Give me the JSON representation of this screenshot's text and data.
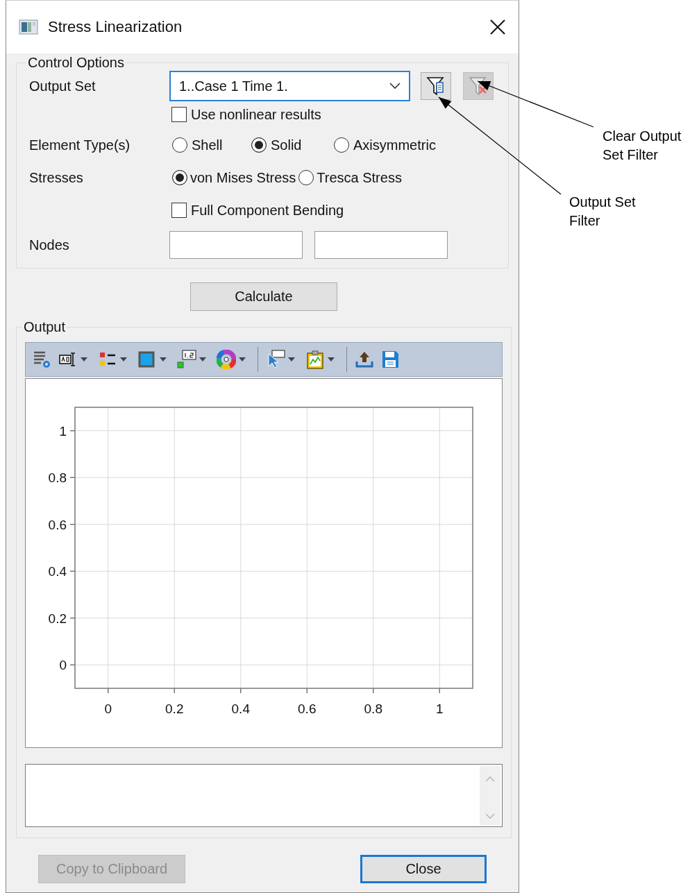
{
  "window": {
    "title": "Stress Linearization"
  },
  "control_options": {
    "title": "Control Options",
    "output_set": {
      "label": "Output Set",
      "value": "1..Case 1 Time 1.",
      "focused": true
    },
    "filter_buttons": [
      {
        "kind": "filter",
        "disabled": false
      },
      {
        "kind": "clear",
        "disabled": true
      }
    ],
    "use_nonlinear": {
      "label": "Use nonlinear results",
      "checked": false
    },
    "element_types": {
      "label": "Element Type(s)",
      "options": [
        {
          "label": "Shell",
          "selected": false
        },
        {
          "label": "Solid",
          "selected": true
        },
        {
          "label": "Axisymmetric",
          "selected": false
        }
      ]
    },
    "stresses": {
      "label": "Stresses",
      "options": [
        {
          "label": "von Mises Stress",
          "selected": true
        },
        {
          "label": "Tresca Stress",
          "selected": false
        }
      ]
    },
    "full_component_bending": {
      "label": "Full Component Bending",
      "checked": false
    },
    "nodes": {
      "label": "Nodes"
    }
  },
  "calculate_button": {
    "label": "Calculate"
  },
  "output": {
    "title": "Output",
    "toolbar": [
      {
        "kind": "tool",
        "dropdown": false
      },
      {
        "kind": "tool",
        "dropdown": true
      },
      {
        "kind": "tool",
        "dropdown": true
      },
      {
        "kind": "tool",
        "dropdown": true
      },
      {
        "kind": "tool",
        "dropdown": true
      },
      {
        "kind": "tool",
        "dropdown": true
      },
      {
        "kind": "separator"
      },
      {
        "kind": "tool",
        "dropdown": true
      },
      {
        "kind": "tool",
        "dropdown": true
      },
      {
        "kind": "separator"
      },
      {
        "kind": "tool",
        "dropdown": false
      },
      {
        "kind": "tool",
        "dropdown": false
      }
    ],
    "chart_data": {
      "type": "line",
      "grid": true,
      "xlim": [
        -0.1,
        1.1
      ],
      "ylim": [
        -0.1,
        1.1
      ],
      "xticks": [
        0,
        0.2,
        0.4,
        0.6,
        0.8,
        1
      ],
      "yticks": [
        0,
        0.2,
        0.4,
        0.6,
        0.8,
        1
      ]
    }
  },
  "buttons": [
    {
      "label": "Copy to Clipboard",
      "disabled": true,
      "default": false
    },
    {
      "label": "Close",
      "disabled": false,
      "default": true
    }
  ],
  "callouts": [
    {
      "text": "Clear Output Set Filter"
    },
    {
      "text": "Output Set Filter"
    }
  ]
}
